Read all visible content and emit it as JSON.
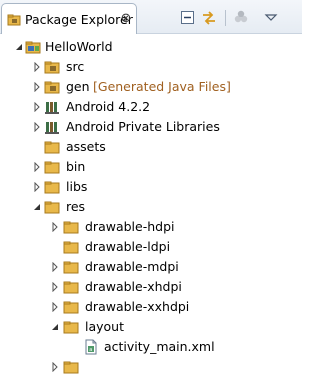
{
  "view": {
    "title": "Package Explorer",
    "close_glyph": "⊗"
  },
  "toolbar": {
    "buttons": [
      {
        "name": "collapse-all-icon"
      },
      {
        "name": "link-with-editor-icon"
      },
      {
        "name": "focus-on-task-icon"
      },
      {
        "name": "view-menu-icon"
      }
    ]
  },
  "colors": {
    "folder": "#e8b84a",
    "package_folder": "#c9a24a",
    "library": "#3c6e46",
    "project": "#3b6fb6"
  },
  "tree": {
    "project": "HelloWorld",
    "src": "src",
    "gen": "gen",
    "gen_decoration": "[Generated Java Files]",
    "android_lib": "Android 4.2.2",
    "private_libs": "Android Private Libraries",
    "assets": "assets",
    "bin": "bin",
    "libs": "libs",
    "res": "res",
    "drawable_hdpi": "drawable-hdpi",
    "drawable_ldpi": "drawable-ldpi",
    "drawable_mdpi": "drawable-mdpi",
    "drawable_xhdpi": "drawable-xhdpi",
    "drawable_xxhdpi": "drawable-xxhdpi",
    "layout": "layout",
    "activity_main": "activity_main.xml"
  }
}
